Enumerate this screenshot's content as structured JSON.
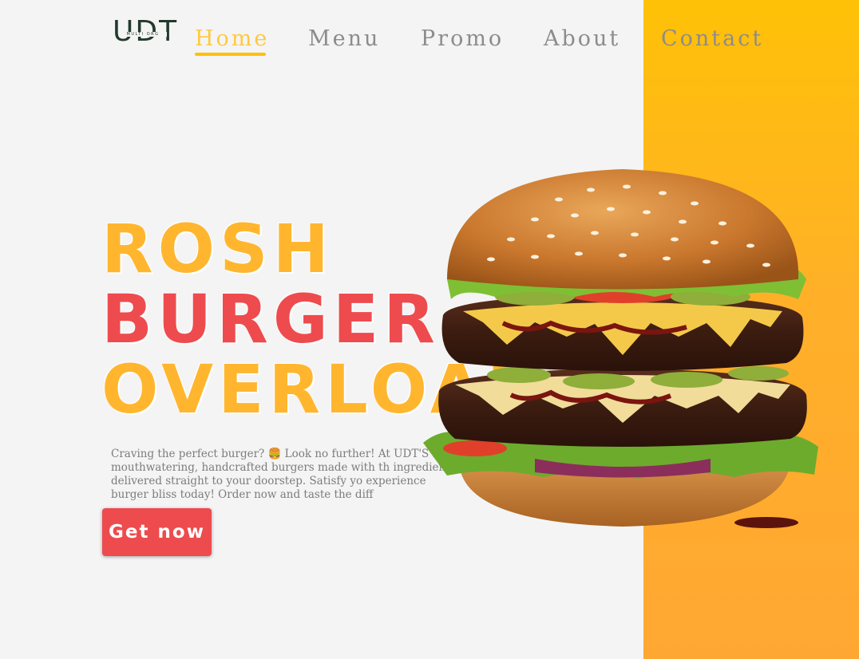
{
  "brand": {
    "logo_text": "UDT",
    "logo_subtext": "MULTI ORG"
  },
  "nav": {
    "items": [
      {
        "label": "Home",
        "active": true
      },
      {
        "label": "Menu",
        "active": false
      },
      {
        "label": "Promo",
        "active": false
      },
      {
        "label": "About",
        "active": false
      },
      {
        "label": "Contact",
        "active": false
      }
    ]
  },
  "hero": {
    "headline_line1": "ROSH",
    "headline_line2": "BURGER",
    "headline_line3": "OVERLOAD",
    "description": "Craving the perfect burger? 🍔 Look no further! At UDT'S serve mouthwatering, handcrafted burgers made with th ingredients, delivered straight to your doorstep. Satisfy yo experience burger bliss today! Order now and taste the diff",
    "cta_label": "Get now"
  },
  "colors": {
    "accent_yellow": "#ffc107",
    "headline_orange": "#ffb62e",
    "headline_red": "#ee4b4e",
    "nav_text": "#8c8c8c",
    "background": "#f4f4f4"
  },
  "images": {
    "hero_image": "burger-image"
  }
}
